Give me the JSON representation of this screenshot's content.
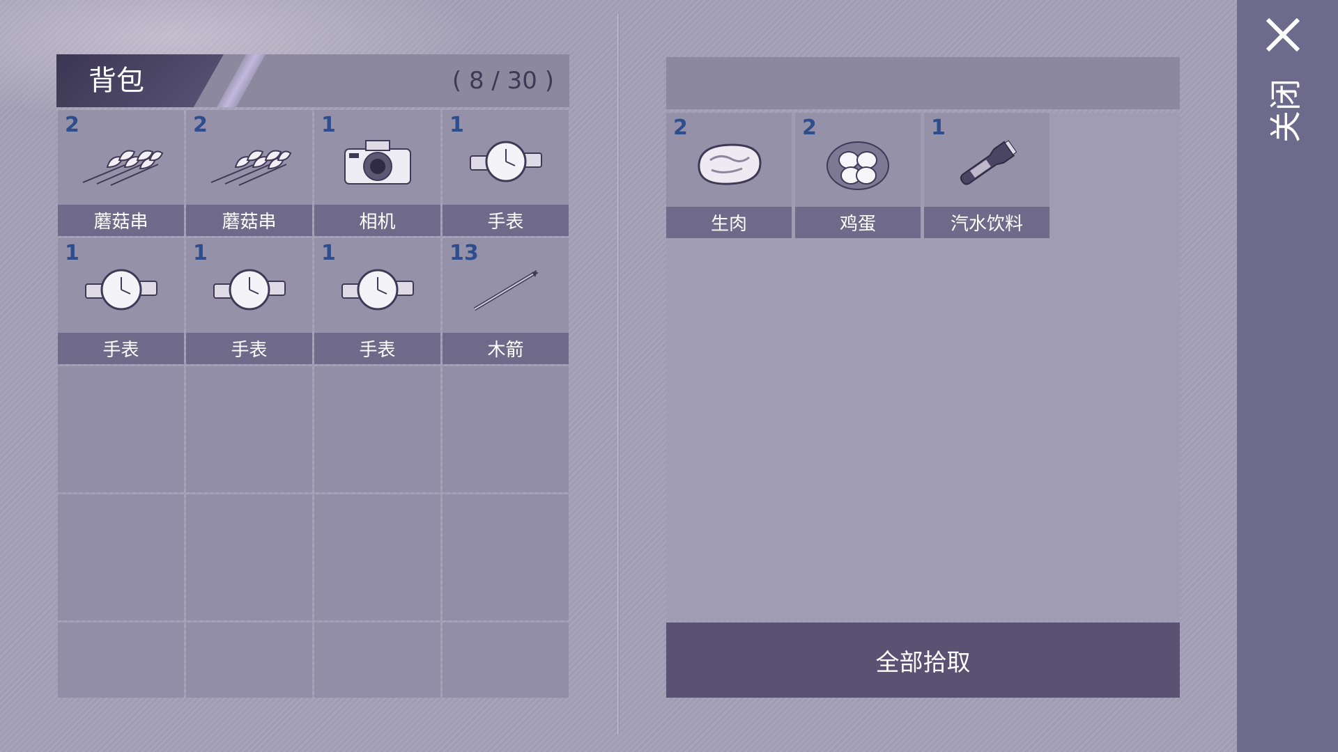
{
  "backpack": {
    "title": "背包",
    "count_text": "( 8 / 30 )",
    "items": [
      {
        "qty": "2",
        "label": "蘑菇串",
        "icon": "mushroom-skewer-icon"
      },
      {
        "qty": "2",
        "label": "蘑菇串",
        "icon": "mushroom-skewer-icon"
      },
      {
        "qty": "1",
        "label": "相机",
        "icon": "camera-icon"
      },
      {
        "qty": "1",
        "label": "手表",
        "icon": "watch-icon"
      },
      {
        "qty": "1",
        "label": "手表",
        "icon": "watch-icon"
      },
      {
        "qty": "1",
        "label": "手表",
        "icon": "watch-icon"
      },
      {
        "qty": "1",
        "label": "手表",
        "icon": "watch-icon"
      },
      {
        "qty": "13",
        "label": "木箭",
        "icon": "wooden-arrow-icon"
      }
    ]
  },
  "loot": {
    "items": [
      {
        "qty": "2",
        "label": "生肉",
        "icon": "raw-meat-icon"
      },
      {
        "qty": "2",
        "label": "鸡蛋",
        "icon": "eggs-icon"
      },
      {
        "qty": "1",
        "label": "汽水饮料",
        "icon": "soda-bottle-icon"
      }
    ],
    "take_all_label": "全部拾取"
  },
  "sidebar": {
    "close_label": "关闭"
  },
  "colors": {
    "qty_text": "#2e4d8c",
    "label_bar": "#6f6a89",
    "take_all_button": "#5b5173",
    "sidebar": "#6e6a8b"
  }
}
